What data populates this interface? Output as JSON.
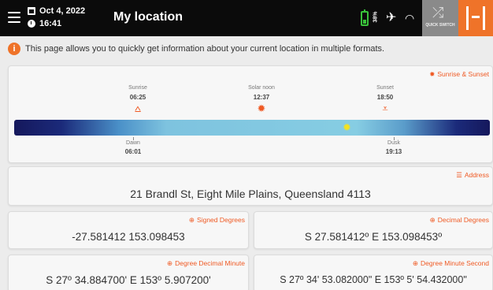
{
  "header": {
    "date": "Oct 4, 2022",
    "time": "16:41",
    "title": "My location",
    "battery_pct": "38%",
    "quick_switch_label": "QUICK SWITCH",
    "icons": [
      "menu-icon",
      "calendar-icon",
      "clock-icon",
      "battery-icon",
      "satellite-icon",
      "wifi-icon",
      "quick-switch-icon",
      "logo-icon"
    ],
    "accent": "#ef7329"
  },
  "info": {
    "text": "This page allows you to quickly get information about your current location in multiple formats."
  },
  "sun": {
    "label": "Sunrise & Sunset",
    "sunrise": {
      "name": "Sunrise",
      "time": "06:25"
    },
    "solar_noon": {
      "name": "Solar noon",
      "time": "12:37"
    },
    "sunset": {
      "name": "Sunset",
      "time": "18:50"
    },
    "dawn": {
      "name": "Dawn",
      "time": "06:01"
    },
    "dusk": {
      "name": "Dusk",
      "time": "19:13"
    }
  },
  "address": {
    "label": "Address",
    "value": "21 Brandl St, Eight Mile Plains, Queensland 4113"
  },
  "signed_degrees": {
    "label": "Signed Degrees",
    "value": "-27.581412 153.098453"
  },
  "decimal_degrees": {
    "label": "Decimal Degrees",
    "value": "S 27.581412º E 153.098453º"
  },
  "degree_decimal_minute": {
    "label": "Degree Decimal Minute",
    "value": "S 27º 34.884700' E 153º 5.907200'"
  },
  "degree_minute_second": {
    "label": "Degree Minute Second",
    "value": "S 27º 34' 53.082000\" E 153º 5' 54.432000\""
  }
}
